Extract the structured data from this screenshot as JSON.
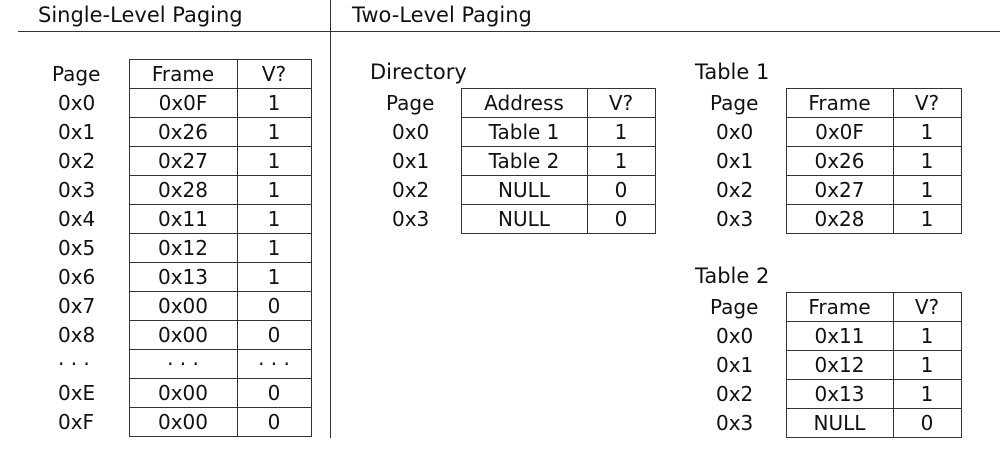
{
  "single": {
    "title": "Single-Level Paging",
    "headers": {
      "page": "Page",
      "frame": "Frame",
      "valid": "V?"
    },
    "rows": [
      {
        "page": "0x0",
        "frame": "0x0F",
        "valid": "1"
      },
      {
        "page": "0x1",
        "frame": "0x26",
        "valid": "1"
      },
      {
        "page": "0x2",
        "frame": "0x27",
        "valid": "1"
      },
      {
        "page": "0x3",
        "frame": "0x28",
        "valid": "1"
      },
      {
        "page": "0x4",
        "frame": "0x11",
        "valid": "1"
      },
      {
        "page": "0x5",
        "frame": "0x12",
        "valid": "1"
      },
      {
        "page": "0x6",
        "frame": "0x13",
        "valid": "1"
      },
      {
        "page": "0x7",
        "frame": "0x00",
        "valid": "0"
      },
      {
        "page": "0x8",
        "frame": "0x00",
        "valid": "0"
      },
      {
        "page": "· · ·",
        "frame": "· · ·",
        "valid": "· · ·"
      },
      {
        "page": "0xE",
        "frame": "0x00",
        "valid": "0"
      },
      {
        "page": "0xF",
        "frame": "0x00",
        "valid": "0"
      }
    ]
  },
  "two_level": {
    "title": "Two-Level Paging",
    "directory": {
      "title": "Directory",
      "headers": {
        "page": "Page",
        "address": "Address",
        "valid": "V?"
      },
      "rows": [
        {
          "page": "0x0",
          "address": "Table 1",
          "valid": "1"
        },
        {
          "page": "0x1",
          "address": "Table 2",
          "valid": "1"
        },
        {
          "page": "0x2",
          "address": "NULL",
          "valid": "0"
        },
        {
          "page": "0x3",
          "address": "NULL",
          "valid": "0"
        }
      ]
    },
    "table1": {
      "title": "Table 1",
      "headers": {
        "page": "Page",
        "frame": "Frame",
        "valid": "V?"
      },
      "rows": [
        {
          "page": "0x0",
          "frame": "0x0F",
          "valid": "1"
        },
        {
          "page": "0x1",
          "frame": "0x26",
          "valid": "1"
        },
        {
          "page": "0x2",
          "frame": "0x27",
          "valid": "1"
        },
        {
          "page": "0x3",
          "frame": "0x28",
          "valid": "1"
        }
      ]
    },
    "table2": {
      "title": "Table 2",
      "headers": {
        "page": "Page",
        "frame": "Frame",
        "valid": "V?"
      },
      "rows": [
        {
          "page": "0x0",
          "frame": "0x11",
          "valid": "1"
        },
        {
          "page": "0x1",
          "frame": "0x12",
          "valid": "1"
        },
        {
          "page": "0x2",
          "frame": "0x13",
          "valid": "1"
        },
        {
          "page": "0x3",
          "frame": "NULL",
          "valid": "0"
        }
      ]
    }
  }
}
